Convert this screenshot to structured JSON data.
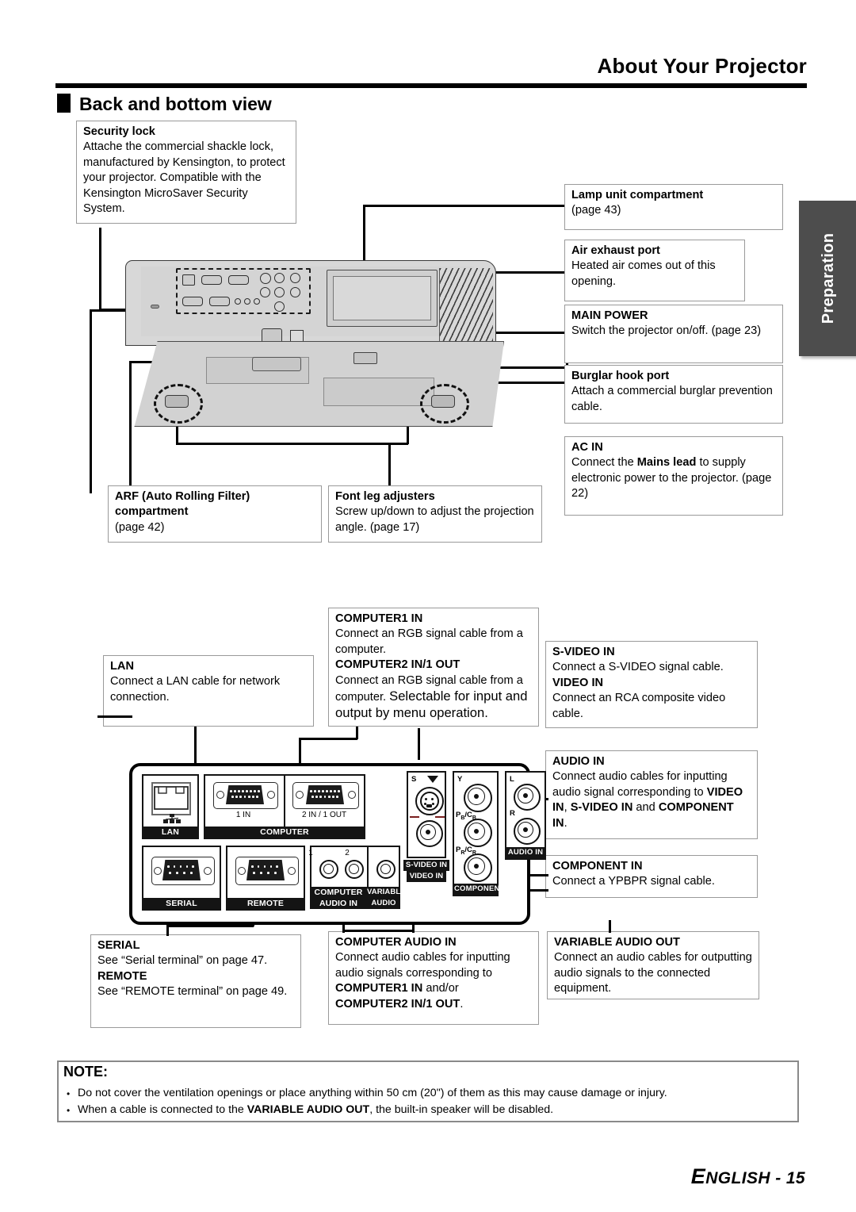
{
  "header": {
    "page_title": "About Your Projector",
    "section_title": "Back and bottom view"
  },
  "side_tab": {
    "label": "Preparation"
  },
  "callouts": {
    "security_lock": {
      "title": "Security lock",
      "body": "Attache the commercial shackle lock, manufactured by Kensington, to protect your projector. Compatible with the Kensington MicroSaver Security System."
    },
    "lamp_unit": {
      "title": "Lamp unit compartment",
      "body": "(page 43)"
    },
    "air_exhaust": {
      "title": "Air exhaust port",
      "body": "Heated air comes out of this opening."
    },
    "main_power": {
      "title": "MAIN POWER",
      "body": "Switch the projector on/off.",
      "page": "(page 23)"
    },
    "burglar_hook": {
      "title": "Burglar hook port",
      "body": "Attach a commercial burglar prevention cable."
    },
    "ac_in": {
      "title": "AC IN",
      "body_1": "Connect the ",
      "body_bold": "Mains lead",
      "body_2": " to supply electronic power to the projector.",
      "page": "(page 22)"
    },
    "arf": {
      "title_1": "ARF (Auto Rolling Filter)",
      "title_2": "compartment",
      "body": "(page 42)"
    },
    "front_leg": {
      "title": "Font leg adjusters",
      "body": "Screw up/down to adjust the projection angle. (page 17)"
    },
    "lan": {
      "title": "LAN",
      "body": "Connect a LAN cable for network connection."
    },
    "computer": {
      "title_1": "COMPUTER1 IN",
      "body_1": "Connect an RGB signal cable from a computer.",
      "title_2": "COMPUTER2 IN/1 OUT",
      "body_2": "Connect an RGB signal cable from a computer. ",
      "body_2_big": "Selectable for input and output by menu operation."
    },
    "video": {
      "title_1": "S-VIDEO IN",
      "body_1": "Connect a S-VIDEO signal cable.",
      "title_2": "VIDEO IN",
      "body_2": "Connect an RCA composite video cable."
    },
    "audio_in": {
      "title": "AUDIO IN",
      "body_1": "Connect audio cables for inputting audio signal corresponding to ",
      "bold_1": "VIDEO IN",
      "mid": ", ",
      "bold_2": "S-VIDEO IN",
      "mid_2": " and ",
      "bold_3": "COMPONENT IN",
      "end": "."
    },
    "component_in": {
      "title": "COMPONENT IN",
      "body": "Connect a YPBPR signal cable."
    },
    "serial_remote": {
      "title_1": "SERIAL",
      "body_1": "See “Serial terminal” on page 47.",
      "title_2": "REMOTE",
      "body_2": "See “REMOTE terminal” on page 49."
    },
    "computer_audio_in": {
      "title": "COMPUTER AUDIO IN",
      "body_1": "Connect audio cables for inputting audio signals corresponding to ",
      "bold_1": "COMPUTER1 IN",
      "mid": " and/or ",
      "bold_2": "COMPUTER2 IN/1 OUT",
      "end": "."
    },
    "variable_audio_out": {
      "title": "VARIABLE AUDIO OUT",
      "body": "Connect an audio cables for outputting audio signals to the connected equipment."
    }
  },
  "connector_panel": {
    "lan_label": "LAN",
    "computer_label": "COMPUTER",
    "computer_1_sub": "1 IN",
    "computer_2_sub": "2 IN / 1 OUT",
    "serial_label": "SERIAL",
    "remote_label": "REMOTE",
    "computer_audio_label_1": "COMPUTER",
    "computer_audio_label_2": "AUDIO IN",
    "computer_audio_jack_1": "1",
    "computer_audio_jack_2": "2",
    "variable_audio_label_1": "VARIABLE",
    "variable_audio_label_2": "AUDIO OUT",
    "svideo_label": "S-VIDEO IN",
    "video_label": "VIDEO IN",
    "svideo_s": "S",
    "component_label": "COMPONENT IN",
    "component_y": "Y",
    "component_pb": "PB/CB",
    "component_pr": "PR/CR",
    "audio_in_label": "AUDIO IN",
    "audio_l": "L",
    "audio_r": "R"
  },
  "note": {
    "label": "NOTE:",
    "items": [
      {
        "text_1": "Do not cover the ventilation openings or place anything within 50 cm (20\") of them as this may cause damage or injury.",
        "bold": "",
        "text_2": ""
      },
      {
        "text_1": "When a cable is connected to the ",
        "bold": "VARIABLE AUDIO OUT",
        "text_2": ", the built-in speaker will be disabled."
      }
    ]
  },
  "footer": {
    "lang_first": "E",
    "lang_rest": "NGLISH",
    "separator": " - ",
    "page_number": "15"
  }
}
